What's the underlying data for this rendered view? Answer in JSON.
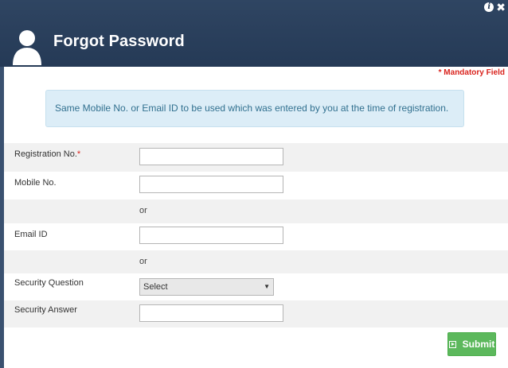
{
  "header": {
    "title": "Forgot Password",
    "info_icon": "i",
    "close_icon": "✖"
  },
  "mandatory_note": "* Mandatory Field",
  "notice": "Same Mobile No. or Email ID to be used which was entered by you at the time of registration.",
  "form": {
    "registration_label": "Registration No.",
    "required_mark": "*",
    "registration_value": "",
    "mobile_label": "Mobile No.",
    "mobile_value": "",
    "or_text_1": "or",
    "email_label": "Email ID",
    "email_value": "",
    "or_text_2": "or",
    "security_question_label": "Security Question",
    "security_question_selected": "Select",
    "security_answer_label": "Security Answer",
    "security_answer_value": ""
  },
  "submit_label": "Submit",
  "colors": {
    "header_bg": "#253a56",
    "notice_bg": "#dcedf7",
    "notice_text": "#31708f",
    "mandatory": "#d9231d",
    "submit_bg": "#5cb85c",
    "row_shade": "#f1f1f1"
  }
}
